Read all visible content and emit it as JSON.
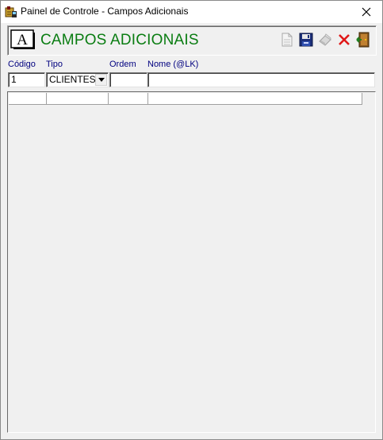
{
  "window": {
    "title": "Painel de Controle - Campos Adicionais"
  },
  "header": {
    "title": "CAMPOS ADICIONAIS",
    "title_color": "#0a7d12",
    "logo_letter": "A",
    "toolbar": [
      {
        "name": "new-document-button",
        "icon": "new-document-icon",
        "enabled": false
      },
      {
        "name": "save-button",
        "icon": "save-icon",
        "enabled": true
      },
      {
        "name": "eraser-button",
        "icon": "eraser-icon",
        "enabled": false
      },
      {
        "name": "delete-button",
        "icon": "delete-x-icon",
        "enabled": true
      },
      {
        "name": "exit-button",
        "icon": "exit-door-icon",
        "enabled": true
      }
    ]
  },
  "form": {
    "labels": {
      "codigo": "Código",
      "tipo": "Tipo",
      "ordem": "Ordem",
      "nome": "Nome (@LK)"
    },
    "values": {
      "codigo": "1",
      "tipo": "CLIENTES",
      "ordem": "",
      "nome": ""
    },
    "label_color": "#00007f"
  },
  "grid": {
    "columns": [
      "",
      "",
      "",
      ""
    ],
    "rows": []
  }
}
